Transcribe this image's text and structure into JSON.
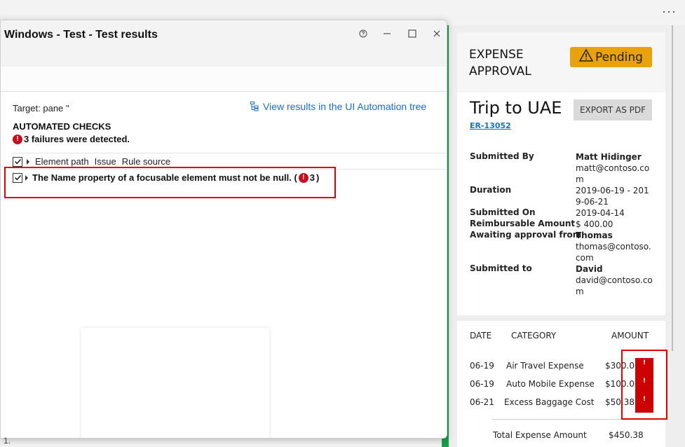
{
  "desktop": {
    "more_label": "···"
  },
  "test_window": {
    "title": "Windows - Test - Test results",
    "target": "Target: pane ''",
    "tree_link": "View results in the UI Automation tree",
    "section_title": "AUTOMATED CHECKS",
    "failures_text": "3 failures were detected.",
    "columns": [
      "Element path",
      "Issue",
      "Rule source"
    ],
    "rule_text": "The Name property of a focusable element must not be null. (",
    "rule_count": "3",
    "rule_close": ")",
    "error_mark": "!",
    "bottom_glyph": "1."
  },
  "expense": {
    "title": "EXPENSE APPROVAL",
    "status": "Pending",
    "trip_title": "Trip to UAE",
    "trip_id": "ER-13052",
    "export_label": "EXPORT AS PDF",
    "details": [
      {
        "label": "Submitted By",
        "name": "Matt Hidinger",
        "value": "matt@contoso.com"
      },
      {
        "label": "Duration",
        "name": "",
        "value": "2019-06-19 - 2019-06-21"
      },
      {
        "label": "Submitted On",
        "name": "",
        "value": "2019-04-14"
      },
      {
        "label": "Reimbursable Amount",
        "name": "",
        "value": "$ 400.00"
      },
      {
        "label": "Awaiting approval from",
        "name": "Thomas",
        "value": "thomas@contoso.com"
      },
      {
        "label": "Submitted to",
        "name": "David",
        "value": "david@contoso.com"
      }
    ],
    "table_headers": {
      "date": "DATE",
      "category": "CATEGORY",
      "amount": "AMOUNT"
    },
    "rows": [
      {
        "date": "06-19",
        "category": "Air Travel Expense",
        "amount": "$300.00"
      },
      {
        "date": "06-19",
        "category": "Auto Mobile Expense",
        "amount": "$100.00"
      },
      {
        "date": "06-21",
        "category": "Excess Baggage Cost",
        "amount": "$50.38"
      }
    ],
    "error_mark": "!",
    "total_label": "Total Expense Amount",
    "total_value": "$450.38"
  },
  "colors": {
    "pending": "#e8a20c",
    "highlight": "#e00000",
    "link": "#1a6fc9",
    "error": "#c50f1f",
    "green_edge": "#1a9f4b"
  }
}
